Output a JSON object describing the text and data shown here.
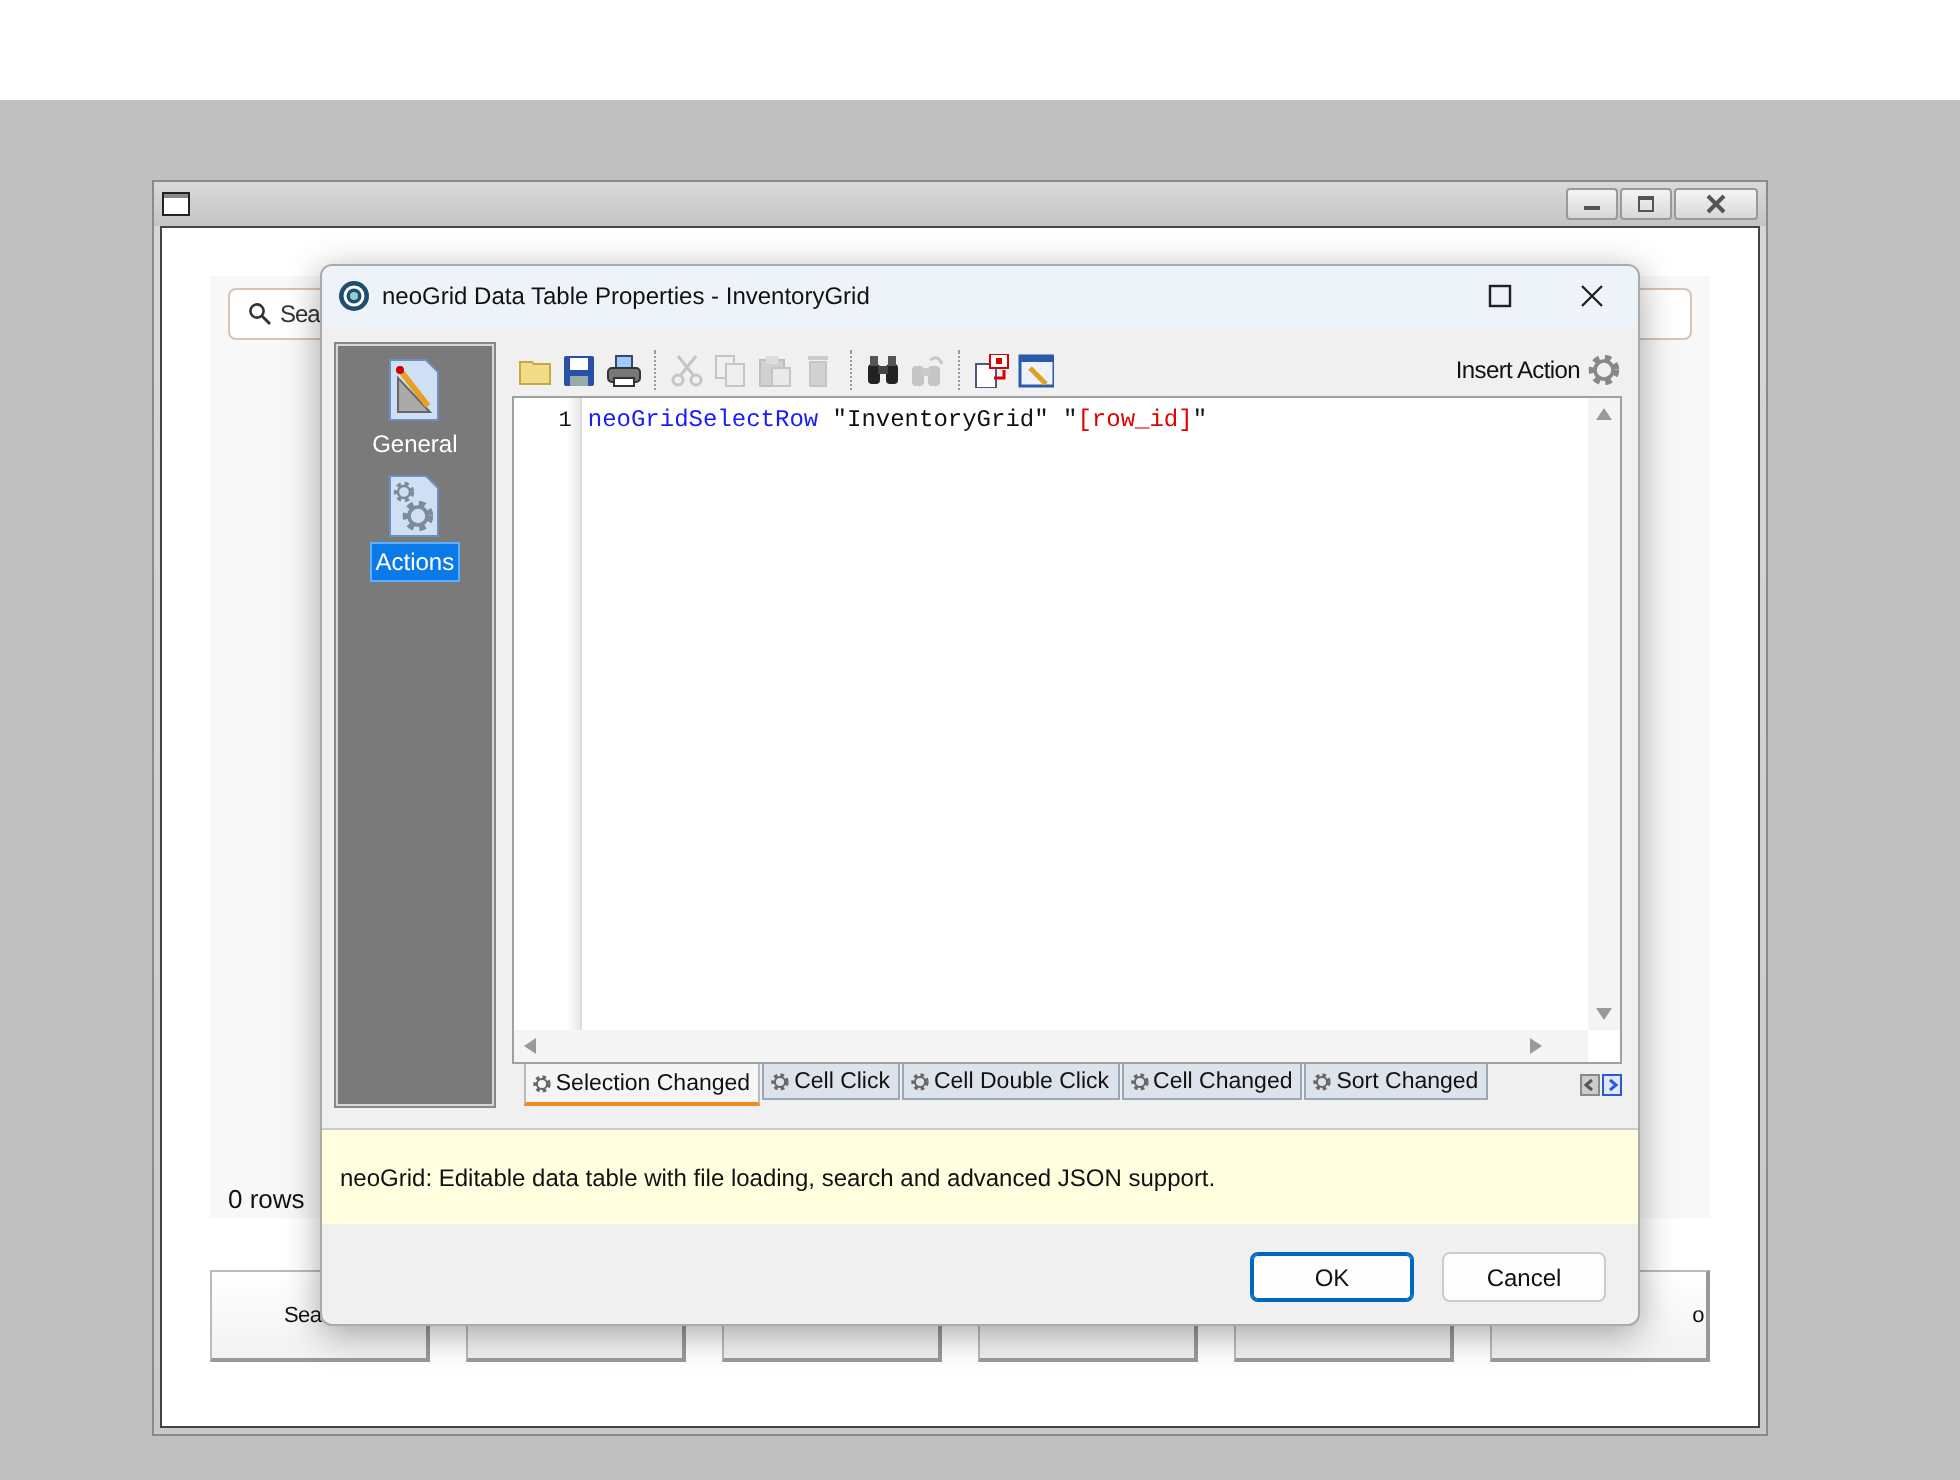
{
  "background_window": {
    "search": {
      "placeholder": "Sea"
    },
    "row_count": "0 rows",
    "buttons": [
      {
        "kind": "labeled",
        "label": "Sea"
      },
      {
        "kind": "blank"
      },
      {
        "kind": "blank"
      },
      {
        "kind": "blank"
      },
      {
        "kind": "blank"
      },
      {
        "kind": "labeled",
        "label": "o"
      }
    ]
  },
  "dialog": {
    "title": "neoGrid Data Table Properties - InventoryGrid",
    "sidebar": [
      {
        "label": "General",
        "kind": "general",
        "selected": false
      },
      {
        "label": "Actions",
        "kind": "actions",
        "selected": true
      }
    ],
    "toolbar": [
      {
        "kind": "open",
        "disabled": false
      },
      {
        "kind": "save",
        "disabled": false
      },
      {
        "kind": "print",
        "disabled": false
      },
      {
        "kind": "separator"
      },
      {
        "kind": "cut",
        "disabled": true
      },
      {
        "kind": "copy",
        "disabled": true
      },
      {
        "kind": "paste",
        "disabled": true
      },
      {
        "kind": "delete",
        "disabled": true
      },
      {
        "kind": "separator"
      },
      {
        "kind": "find",
        "disabled": false
      },
      {
        "kind": "replace",
        "disabled": true
      },
      {
        "kind": "separator"
      },
      {
        "kind": "insert_variable",
        "disabled": false
      },
      {
        "kind": "edit_window",
        "disabled": false
      }
    ],
    "insert_action": "Insert Action",
    "editor": {
      "line_number": "1",
      "tokens": [
        {
          "kind": "command",
          "text": "neoGridSelectRow"
        },
        {
          "kind": "plain",
          "text": " \"InventoryGrid\" \""
        },
        {
          "kind": "variable",
          "text": "[row_id]"
        },
        {
          "kind": "plain",
          "text": "\""
        }
      ]
    },
    "event_tabs": [
      {
        "label": "Selection Changed",
        "selected": true
      },
      {
        "label": "Cell Click",
        "selected": false
      },
      {
        "label": "Cell Double Click",
        "selected": false
      },
      {
        "label": "Cell Changed",
        "selected": false
      },
      {
        "label": "Sort Changed",
        "selected": false
      }
    ],
    "description": "neoGrid: Editable data table with file loading, search and advanced JSON support.",
    "buttons": [
      {
        "label": "OK",
        "default": true
      },
      {
        "label": "Cancel",
        "default": false
      }
    ]
  }
}
